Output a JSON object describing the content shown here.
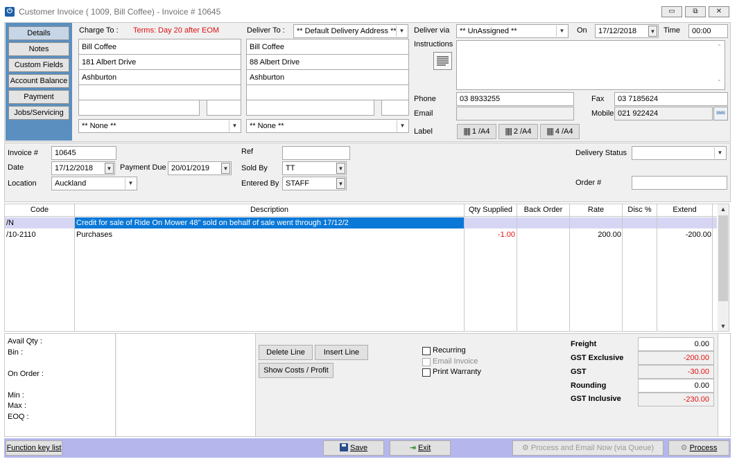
{
  "window": {
    "title": "Customer Invoice ( 1009, Bill Coffee) - Invoice # 10645",
    "app_icon": "power-icon",
    "min_label": "▭",
    "max_label": "⧉",
    "close_label": "✕"
  },
  "nav": {
    "items": [
      {
        "label": "Details"
      },
      {
        "label": "Notes"
      },
      {
        "label": "Custom Fields"
      },
      {
        "label": "Account Balance"
      },
      {
        "label": "Payment"
      },
      {
        "label": "Jobs/Servicing"
      }
    ]
  },
  "charge_to": {
    "label": "Charge To :",
    "terms": "Terms: Day 20 after EOM",
    "lines": [
      "Bill Coffee",
      "181 Albert Drive",
      "Ashburton",
      "",
      "",
      ""
    ],
    "select_value": "** None **"
  },
  "deliver_to": {
    "label": "Deliver To :",
    "address_select": "** Default Delivery Address **",
    "lines": [
      "Bill Coffee",
      "88 Albert Drive",
      "Ashburton",
      "",
      "",
      ""
    ],
    "select_value": "** None **"
  },
  "delivery": {
    "deliver_via_label": "Deliver via",
    "deliver_via_value": "** UnAssigned **",
    "on_label": "On",
    "on_value": "17/12/2018",
    "time_label": "Time",
    "time_value": "00:00",
    "instructions_label": "Instructions",
    "instructions_value": "",
    "instructions_icon": "notepad-icon"
  },
  "contact": {
    "phone_label": "Phone",
    "phone_value": "03 8933255",
    "email_label": "Email",
    "email_value": "",
    "fax_label": "Fax",
    "fax_value": "03 7185624",
    "mobile_label": "Mobile",
    "mobile_value": "021 922424",
    "sms_icon": "SMS",
    "label_label": "Label",
    "label_buttons": [
      "1 /A4",
      "2 /A4",
      "4 /A4"
    ],
    "barcode_icon": "barcode-icon"
  },
  "invoice": {
    "invoice_no_label": "Invoice #",
    "invoice_no_value": "10645",
    "date_label": "Date",
    "date_value": "17/12/2018",
    "payment_due_label": "Payment Due",
    "payment_due_value": "20/01/2019",
    "location_label": "Location",
    "location_value": "Auckland",
    "ref_label": "Ref",
    "ref_value": "",
    "sold_by_label": "Sold By",
    "sold_by_value": "TT",
    "entered_by_label": "Entered By",
    "entered_by_value": "STAFF",
    "delivery_status_label": "Delivery Status",
    "delivery_status_value": "",
    "order_no_label": "Order #",
    "order_no_value": ""
  },
  "grid": {
    "columns": [
      "Code",
      "Description",
      "Qty Supplied",
      "Back Order",
      "Rate",
      "Disc %",
      "Extend"
    ],
    "rows": [
      {
        "code": "/N",
        "description": "Credit for sale of Ride On Mower 48\" sold on behalf of sale went through 17/12/2",
        "qty": "",
        "back_order": "",
        "rate": "",
        "disc": "",
        "extend": ""
      },
      {
        "code": "/10-2110",
        "description": "Purchases",
        "qty": "-1.00",
        "back_order": "",
        "rate": "200.00",
        "disc": "",
        "extend": "-200.00"
      }
    ]
  },
  "stock": {
    "avail_qty": "Avail Qty :",
    "bin": "Bin :",
    "on_order": "On Order :",
    "min": "Min :",
    "max": "Max :",
    "eoq": "EOQ :"
  },
  "actions": {
    "delete_line": "Delete Line",
    "insert_line": "Insert Line",
    "show_costs": "Show Costs / Profit",
    "recurring": "Recurring",
    "email_invoice": "Email Invoice",
    "print_warranty": "Print Warranty"
  },
  "totals": {
    "freight_label": "Freight",
    "freight_value": "0.00",
    "gst_excl_label": "GST Exclusive",
    "gst_excl_value": "-200.00",
    "gst_label": "GST",
    "gst_value": "-30.00",
    "rounding_label": "Rounding",
    "rounding_value": "0.00",
    "gst_incl_label": "GST Inclusive",
    "gst_incl_value": "-230.00"
  },
  "footer": {
    "function_key_list": "Function key list",
    "save": "Save",
    "exit": "Exit",
    "process_email": "Process and Email Now (via Queue)",
    "process": "Process",
    "save_icon": "floppy-icon",
    "exit_icon": "exit-door-icon",
    "process_icon": "gear-icon"
  },
  "colors": {
    "nav_panel": "#5b8fc0",
    "footer_bar": "#b4b6ec",
    "selected_row": "#d6d6f4",
    "selection_highlight": "#0a78d7",
    "negative": "#e01010"
  }
}
